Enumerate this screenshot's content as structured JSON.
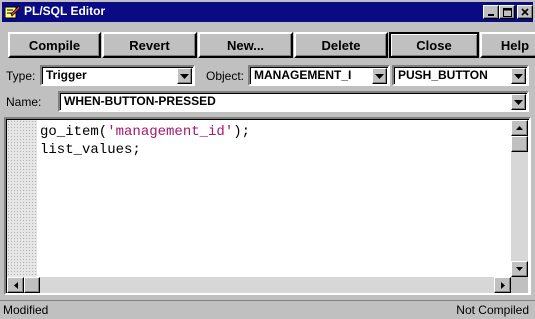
{
  "window": {
    "title": "PL/SQL Editor",
    "title_bar_color": "#0a0a84",
    "icon": "edit-pencil-icon",
    "caption_buttons": [
      "minimize",
      "maximize",
      "close"
    ]
  },
  "toolbar": {
    "compile": "Compile",
    "revert": "Revert",
    "new": "New...",
    "delete": "Delete",
    "close": "Close",
    "help": "Help"
  },
  "fields": {
    "type_label": "Type:",
    "type_value": "Trigger",
    "object_label": "Object:",
    "object_value": "MANAGEMENT_I",
    "object2_value": "PUSH_BUTTON",
    "name_label": "Name:",
    "name_value": "WHEN-BUTTON-PRESSED"
  },
  "code": {
    "line1_func": "go_item(",
    "line1_string": "'management_id'",
    "line1_end": ");",
    "line2": "list_values;",
    "string_color": "#a0186e"
  },
  "status": {
    "left": "Modified",
    "right": "Not Compiled"
  }
}
